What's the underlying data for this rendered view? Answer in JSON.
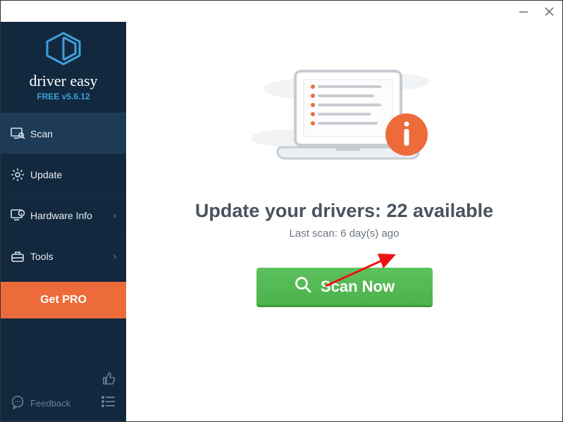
{
  "app": {
    "brand": "driver easy",
    "version": "FREE v5.6.12"
  },
  "sidebar": {
    "items": [
      {
        "label": "Scan"
      },
      {
        "label": "Update"
      },
      {
        "label": "Hardware Info"
      },
      {
        "label": "Tools"
      }
    ],
    "getpro": "Get PRO",
    "feedback": "Feedback"
  },
  "main": {
    "headline_prefix": "Update your drivers: ",
    "headline_count": "22",
    "headline_suffix": " available",
    "lastscan_prefix": "Last scan: ",
    "lastscan_value": "6 day(s) ago",
    "scan_button": "Scan Now"
  }
}
